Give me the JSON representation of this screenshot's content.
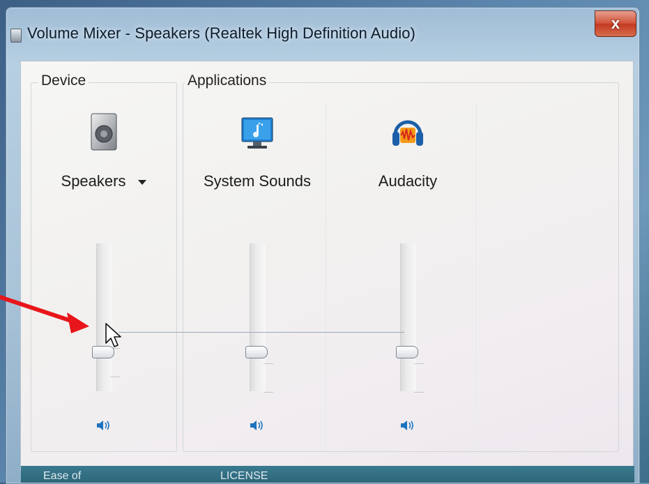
{
  "window": {
    "title": "Volume Mixer - Speakers (Realtek High Definition Audio)",
    "close_glyph": "x"
  },
  "groups": {
    "device_label": "Device",
    "applications_label": "Applications"
  },
  "channels": [
    {
      "name": "Speakers",
      "icon": "speaker-device-icon",
      "has_dropdown": true,
      "volume_percent": 25,
      "muted": false
    },
    {
      "name": "System Sounds",
      "icon": "system-sounds-icon",
      "has_dropdown": false,
      "volume_percent": 25,
      "muted": false
    },
    {
      "name": "Audacity",
      "icon": "audacity-icon",
      "has_dropdown": false,
      "volume_percent": 25,
      "muted": false
    }
  ],
  "colors": {
    "accent_blue": "#1e73be",
    "annotation_red": "#e8151a",
    "close_red": "#c8452b"
  },
  "desktop_bottom": {
    "left_text": "Ease of",
    "center_text": "LICENSE"
  }
}
